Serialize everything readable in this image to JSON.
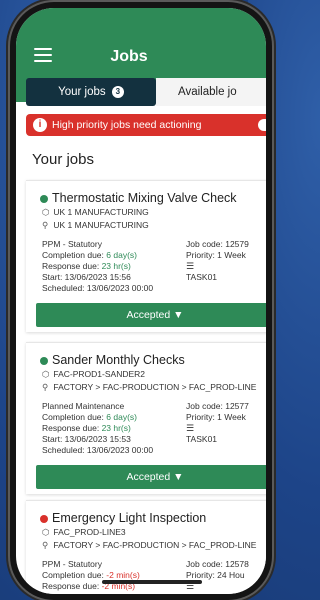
{
  "header": {
    "title": "Jobs",
    "menu_icon": "hamburger-icon"
  },
  "tabs": [
    {
      "label": "Your jobs",
      "badge": "3",
      "active": true
    },
    {
      "label": "Available jo",
      "active": false
    }
  ],
  "alert": {
    "text": "High priority jobs need actioning",
    "icon": "info-icon",
    "color": "#d9312b"
  },
  "section_title": "Your jobs",
  "jobs": [
    {
      "title": "Thermostatic Mixing Valve Check",
      "status_color": "#2e8a57",
      "site_line": "UK 1 MANUFACTURING",
      "location_line": "UK 1 MANUFACTURING",
      "type": "PPM - Statutory",
      "completion_label": "Completion due:",
      "completion_value": "6 day(s)",
      "response_label": "Response due:",
      "response_value": "23 hr(s)",
      "start": "Start: 13/06/2023 15:56",
      "scheduled": "Scheduled: 13/06/2023 00:00",
      "job_code": "Job code: 12579",
      "priority": "Priority: 1 Week",
      "task": "TASK01",
      "button": "Accepted ▼"
    },
    {
      "title": "Sander Monthly Checks",
      "status_color": "#2e8a57",
      "site_line": "FAC-PROD1-SANDER2",
      "location_line": "FACTORY > FAC-PRODUCTION > FAC_PROD-LINE",
      "type": "Planned Maintenance",
      "completion_label": "Completion due:",
      "completion_value": "6 day(s)",
      "response_label": "Response due:",
      "response_value": "23 hr(s)",
      "start": "Start: 13/06/2023 15:53",
      "scheduled": "Scheduled: 13/06/2023 00:00",
      "job_code": "Job code: 12577",
      "priority": "Priority: 1 Week",
      "task": "TASK01",
      "button": "Accepted ▼"
    },
    {
      "title": "Emergency Light Inspection",
      "status_color": "#d9312b",
      "site_line": "FAC_PROD-LINE3",
      "location_line": "FACTORY > FAC-PRODUCTION > FAC_PROD-LINE",
      "type": "PPM - Statutory",
      "completion_label": "Completion due:",
      "completion_value": "-2 min(s)",
      "response_label": "Response due:",
      "response_value": "-2 min(s)",
      "job_code": "Job code: 12578",
      "priority": "Priority: 24 Hou"
    }
  ]
}
